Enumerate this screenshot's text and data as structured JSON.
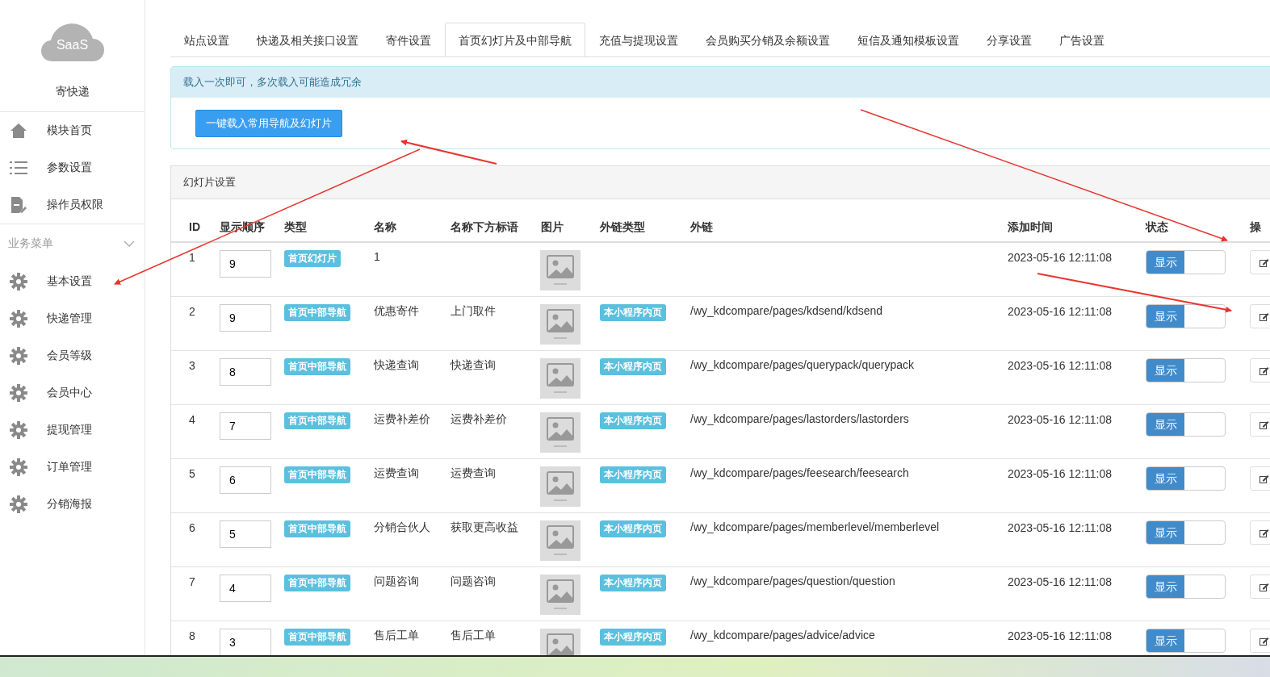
{
  "sidebar": {
    "logo_text": "SaaS",
    "app_name": "寄快递",
    "top_items": [
      {
        "label": "模块首页",
        "kind": "home"
      },
      {
        "label": "参数设置",
        "kind": "list"
      },
      {
        "label": "操作员权限",
        "kind": "doc"
      }
    ],
    "section": {
      "title": "业务菜单",
      "expanded": true
    },
    "items": [
      {
        "label": "基本设置"
      },
      {
        "label": "快递管理"
      },
      {
        "label": "会员等级"
      },
      {
        "label": "会员中心"
      },
      {
        "label": "提现管理"
      },
      {
        "label": "订单管理"
      },
      {
        "label": "分销海报"
      }
    ]
  },
  "tabs": [
    {
      "label": "站点设置",
      "selected": false
    },
    {
      "label": "快递及相关接口设置",
      "selected": false
    },
    {
      "label": "寄件设置",
      "selected": false
    },
    {
      "label": "首页幻灯片及中部导航",
      "selected": true
    },
    {
      "label": "充值与提现设置",
      "selected": false
    },
    {
      "label": "会员购买分销及余额设置",
      "selected": false
    },
    {
      "label": "短信及通知模板设置",
      "selected": false
    },
    {
      "label": "分享设置",
      "selected": false
    },
    {
      "label": "广告设置",
      "selected": false
    }
  ],
  "notice": "载入一次即可，多次载入可能造成冗余",
  "load_button": "一键载入常用导航及幻灯片",
  "panel": {
    "title": "幻灯片设置",
    "columns": [
      "ID",
      "显示顺序",
      "类型",
      "名称",
      "名称下方标语",
      "图片",
      "外链类型",
      "外链",
      "添加时间",
      "状态",
      "操"
    ],
    "rows": [
      {
        "id": "1",
        "order": "9",
        "type": "首页幻灯片",
        "name": "1",
        "subtitle": "",
        "link_type": "",
        "link": "",
        "added": "2023-05-16 12:11:08",
        "status": {
          "label": "显示",
          "on": true
        }
      },
      {
        "id": "2",
        "order": "9",
        "type": "首页中部导航",
        "name": "优惠寄件",
        "subtitle": "上门取件",
        "link_type": "本小程序内页",
        "link": "/wy_kdcompare/pages/kdsend/kdsend",
        "added": "2023-05-16 12:11:08",
        "status": {
          "label": "显示",
          "on": true
        }
      },
      {
        "id": "3",
        "order": "8",
        "type": "首页中部导航",
        "name": "快递查询",
        "subtitle": "快递查询",
        "link_type": "本小程序内页",
        "link": "/wy_kdcompare/pages/querypack/querypack",
        "added": "2023-05-16 12:11:08",
        "status": {
          "label": "显示",
          "on": true
        }
      },
      {
        "id": "4",
        "order": "7",
        "type": "首页中部导航",
        "name": "运费补差价",
        "subtitle": "运费补差价",
        "link_type": "本小程序内页",
        "link": "/wy_kdcompare/pages/lastorders/lastorders",
        "added": "2023-05-16 12:11:08",
        "status": {
          "label": "显示",
          "on": true
        }
      },
      {
        "id": "5",
        "order": "6",
        "type": "首页中部导航",
        "name": "运费查询",
        "subtitle": "运费查询",
        "link_type": "本小程序内页",
        "link": "/wy_kdcompare/pages/feesearch/feesearch",
        "added": "2023-05-16 12:11:08",
        "status": {
          "label": "显示",
          "on": true
        }
      },
      {
        "id": "6",
        "order": "5",
        "type": "首页中部导航",
        "name": "分销合伙人",
        "subtitle": "获取更高收益",
        "link_type": "本小程序内页",
        "link": "/wy_kdcompare/pages/memberlevel/memberlevel",
        "added": "2023-05-16 12:11:08",
        "status": {
          "label": "显示",
          "on": true
        }
      },
      {
        "id": "7",
        "order": "4",
        "type": "首页中部导航",
        "name": "问题咨询",
        "subtitle": "问题咨询",
        "link_type": "本小程序内页",
        "link": "/wy_kdcompare/pages/question/question",
        "added": "2023-05-16 12:11:08",
        "status": {
          "label": "显示",
          "on": true
        }
      },
      {
        "id": "8",
        "order": "3",
        "type": "首页中部导航",
        "name": "售后工单",
        "subtitle": "售后工单",
        "link_type": "本小程序内页",
        "link": "/wy_kdcompare/pages/advice/advice",
        "added": "2023-05-16 12:11:08",
        "status": {
          "label": "显示",
          "on": true
        }
      }
    ]
  }
}
